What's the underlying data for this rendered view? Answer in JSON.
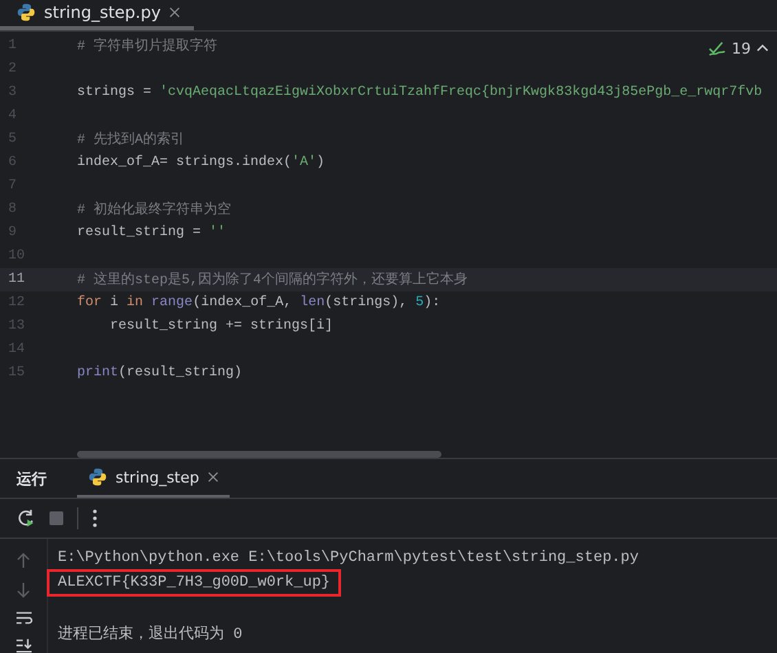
{
  "editor_tabs": [
    {
      "label": "string_step.py",
      "selected": true
    }
  ],
  "inspections": {
    "count": "19"
  },
  "code_lines": [
    {
      "number": "1",
      "current": false,
      "tokens": [
        {
          "kind": "comment",
          "text": "# 字符串切片提取字符"
        }
      ]
    },
    {
      "number": "2",
      "current": false
    },
    {
      "number": "3",
      "current": false,
      "tokens": [
        {
          "kind": "plain",
          "text": "strings = "
        },
        {
          "kind": "string",
          "text": "'cvqAeqacLtqazEigwiXobxrCrtuiTzahfFreqc{bnjrKwgk83kgd43j85ePgb_e_rwqr7fvb"
        }
      ]
    },
    {
      "number": "4",
      "current": false
    },
    {
      "number": "5",
      "current": false,
      "tokens": [
        {
          "kind": "comment",
          "text": "# 先找到A的索引"
        }
      ]
    },
    {
      "number": "6",
      "current": false,
      "tokens": [
        {
          "kind": "plain",
          "text": "index_of_A= strings.index("
        },
        {
          "kind": "string",
          "text": "'A'"
        },
        {
          "kind": "plain",
          "text": ")"
        }
      ]
    },
    {
      "number": "7",
      "current": false
    },
    {
      "number": "8",
      "current": false,
      "tokens": [
        {
          "kind": "comment",
          "text": "# 初始化最终字符串为空"
        }
      ]
    },
    {
      "number": "9",
      "current": false,
      "tokens": [
        {
          "kind": "plain",
          "text": "result_string = "
        },
        {
          "kind": "string",
          "text": "''"
        }
      ]
    },
    {
      "number": "10",
      "current": false
    },
    {
      "number": "11",
      "current": true,
      "tokens": [
        {
          "kind": "comment",
          "text": "# 这里的step是5,因为除了4个间隔的字符外，还要算上它本身"
        }
      ]
    },
    {
      "number": "12",
      "current": false,
      "tokens": [
        {
          "kind": "keyword",
          "text": "for"
        },
        {
          "kind": "plain",
          "text": " i "
        },
        {
          "kind": "keyword",
          "text": "in"
        },
        {
          "kind": "builtin",
          "text": " range"
        },
        {
          "kind": "plain",
          "text": "(index_of_A, "
        },
        {
          "kind": "builtin",
          "text": "len"
        },
        {
          "kind": "plain",
          "text": "(strings), "
        },
        {
          "kind": "number",
          "text": "5"
        },
        {
          "kind": "plain",
          "text": "):"
        }
      ]
    },
    {
      "number": "13",
      "current": false,
      "tokens": [
        {
          "kind": "plain",
          "text": "    result_string += strings[i]"
        }
      ]
    },
    {
      "number": "14",
      "current": false
    },
    {
      "number": "15",
      "current": false,
      "tokens": [
        {
          "kind": "builtin",
          "text": "print"
        },
        {
          "kind": "plain",
          "text": "(result_string)"
        }
      ]
    }
  ],
  "run_panel": {
    "title": "运行",
    "tabs": [
      {
        "label": "string_step",
        "selected": true
      }
    ],
    "output": [
      {
        "kind": "command",
        "text": "E:\\Python\\python.exe E:\\tools\\PyCharm\\pytest\\test\\string_step.py",
        "boxed": false
      },
      {
        "kind": "output",
        "text": "ALEXCTF{K33P_7H3_g00D_w0rk_up}",
        "boxed": true
      },
      {
        "kind": "status",
        "text": "进程已结束，退出代码为 0",
        "boxed": false
      }
    ]
  }
}
